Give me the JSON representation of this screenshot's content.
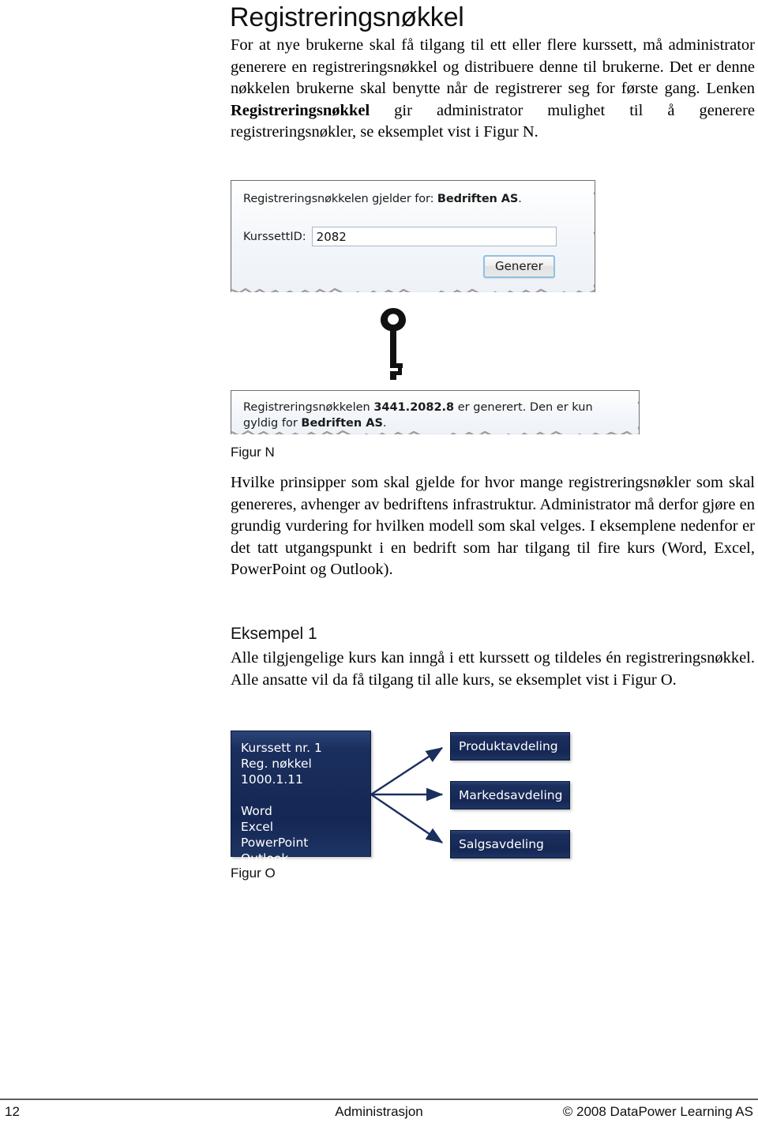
{
  "page": {
    "title": "Registreringsnøkkel"
  },
  "paragraphs": {
    "intro_1": "For at nye brukerne skal få tilgang til ett eller flere kurssett, må administrator generere en registreringsnøkkel og distribuere denne til brukerne. Det er denne nøkkelen brukerne skal benytte når de registrerer seg for første gang. Lenken ",
    "intro_bold": "Registreringsnøkkel",
    "intro_2": " gir administrator mulighet til å generere registreringsnøkler, se eksemplet vist i Figur N.",
    "middle": "Hvilke prinsipper som skal gjelde for hvor mange registreringsnøkler som skal genereres, avhenger av bedriftens infrastruktur. Administrator må derfor gjøre en grundig vurdering for hvilken modell som skal velges. I eksemplene nedenfor er det tatt utgangspunkt i en bedrift som har tilgang til fire kurs (Word, Excel, PowerPoint og Outlook).",
    "example_1_heading": "Eksempel 1",
    "example_1_body": "Alle tilgjengelige kurs kan inngå i ett kurssett og tildeles én registreringsnøkkel. Alle ansatte vil da få tilgang til alle kurs, se eksemplet vist i Figur O."
  },
  "figure_n": {
    "caption": "Figur N",
    "form_panel": {
      "header_prefix": "Registreringsnøkkelen gjelder for: ",
      "header_company": "Bedriften AS",
      "header_suffix": ".",
      "field_label": "KurssettID:",
      "field_value": "2082",
      "field_placeholder": "",
      "button_label": "Generer"
    },
    "key_icon": "key-icon",
    "result_panel": {
      "msg_prefix": "Registreringsnøkkelen ",
      "msg_key": "3441.2082.8",
      "msg_middle": " er generert. Den er kun gyldig for ",
      "msg_company": "Bedriften AS",
      "msg_suffix": "."
    }
  },
  "figure_o": {
    "caption": "Figur O",
    "main_box": "Kurssett nr. 1\nReg. nøkkel 1000.1.11\n\nWord\nExcel\nPowerPoint\nOutlook",
    "leaf_boxes": [
      {
        "label": "Produktavdeling"
      },
      {
        "label": "Markedsavdeling"
      },
      {
        "label": "Salgsavdeling"
      }
    ],
    "box_color": "#1b2f5e",
    "line_color": "#1b2f5e"
  },
  "footer": {
    "page_number": "12",
    "center": "Administrasjon",
    "copyright": "© 2008 DataPower Learning AS"
  }
}
